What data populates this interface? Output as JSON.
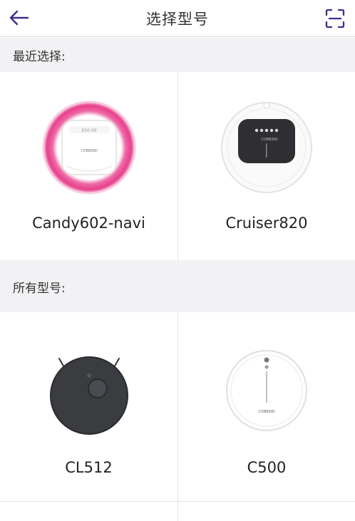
{
  "header": {
    "title": "选择型号",
    "back_icon": "arrow-left-icon",
    "scan_icon": "scan-frame-icon",
    "accent": "#3d2f8f"
  },
  "recent": {
    "title": "最近选择:",
    "items": [
      {
        "name": "Candy602-navi",
        "image": "pink-robot-vacuum"
      },
      {
        "name": "Cruiser820",
        "image": "white-robot-vacuum-dark-panel"
      }
    ]
  },
  "all": {
    "title": "所有型号:",
    "items": [
      {
        "name": "CL512",
        "image": "black-robot-vacuum-lidar"
      },
      {
        "name": "C500",
        "image": "white-robot-vacuum"
      }
    ]
  }
}
